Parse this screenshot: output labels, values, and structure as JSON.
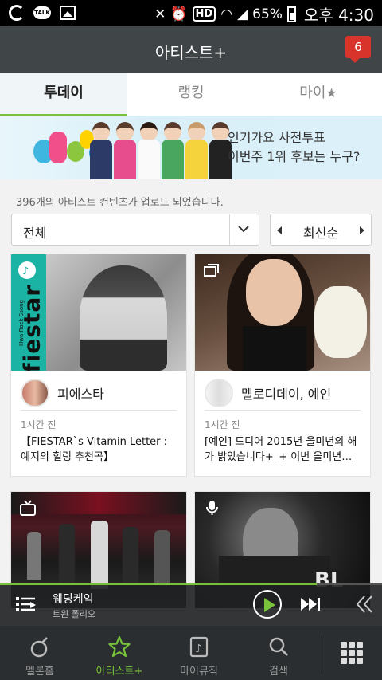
{
  "status_bar": {
    "battery": "65%",
    "time": "오후 4:30",
    "left_icons": [
      "g-app-icon",
      "kakaotalk-icon",
      "gallery-icon"
    ],
    "hd_label": "HD"
  },
  "header": {
    "title": "아티스트+",
    "notification_count": "6"
  },
  "tabs": [
    {
      "label": "투데이",
      "active": true
    },
    {
      "label": "랭킹",
      "active": false
    },
    {
      "label": "마이",
      "active": false,
      "icon": "star-icon"
    }
  ],
  "banner": {
    "line1": "인기가요 사전투표",
    "line2": "이번주 1위 후보는 누구?"
  },
  "content": {
    "upload_count_text": "396개의 아티스트 컨텐츠가 업로드 되었습니다.",
    "filter_value": "전체",
    "sort_value": "최신순"
  },
  "cards": [
    {
      "type_icon": "music-note-icon",
      "artist": "피에스타",
      "time": "1시간 전",
      "title": "【FIESTAR`s Vitamin Letter : 예지의 힐링 추천곡】",
      "image_text": "fiestar",
      "image_subtext": "Hwa-Rock Ssong"
    },
    {
      "type_icon": "gallery-icon",
      "artist": "멜로디데이, 예인",
      "time": "1시간 전",
      "title": "[예인] 드디어 2015년 을미년의 해가 밝았습니다+_+ 이번 을미년…"
    },
    {
      "type_icon": "tv-icon"
    },
    {
      "type_icon": "microphone-icon",
      "image_text": "BL"
    }
  ],
  "player": {
    "song_title": "웨딩케익",
    "song_artist": "트윈 폴리오",
    "progress": 0.83
  },
  "bottom_nav": [
    {
      "label": "멜론홈",
      "icon": "melon-home-icon",
      "active": false
    },
    {
      "label": "아티스트+",
      "icon": "star-icon",
      "active": true
    },
    {
      "label": "마이뮤직",
      "icon": "my-music-icon",
      "active": false
    },
    {
      "label": "검색",
      "icon": "search-icon",
      "active": false
    }
  ],
  "colors": {
    "accent": "#78c33a",
    "header_bg": "#404548",
    "notification": "#d9342b",
    "nav_bg": "#2b2e30"
  }
}
